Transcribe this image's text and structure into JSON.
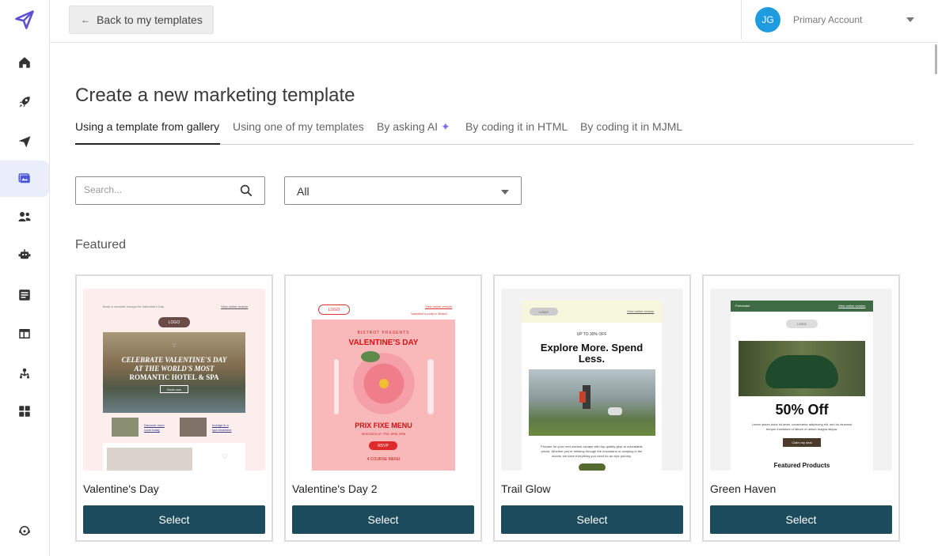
{
  "topbar": {
    "back_label": "Back to my templates",
    "account_initials": "JG",
    "account_name": "Primary Account"
  },
  "sidebar": {
    "items": [
      {
        "icon": "logo-paper-plane-icon"
      },
      {
        "icon": "home-icon"
      },
      {
        "icon": "rocket-icon"
      },
      {
        "icon": "send-icon"
      },
      {
        "icon": "templates-icon",
        "active": true
      },
      {
        "icon": "contacts-icon"
      },
      {
        "icon": "robot-icon"
      },
      {
        "icon": "forms-icon"
      },
      {
        "icon": "layout-icon"
      },
      {
        "icon": "integrations-icon"
      },
      {
        "icon": "apps-icon"
      },
      {
        "icon": "support-icon"
      }
    ]
  },
  "page": {
    "title": "Create a new marketing template",
    "tabs": [
      {
        "label": "Using a template from gallery",
        "active": true
      },
      {
        "label": "Using one of my templates"
      },
      {
        "label": "By asking AI"
      },
      {
        "label": "By coding it in HTML"
      },
      {
        "label": "By coding it in MJML"
      }
    ]
  },
  "search": {
    "placeholder": "Search..."
  },
  "filter": {
    "value": "All"
  },
  "section": {
    "title": "Featured"
  },
  "cards": [
    {
      "name": "Valentine's Day",
      "button": "Select",
      "preview": {
        "preheader": "Book a romantic escape for Valentine's Day",
        "view_online": "View online version",
        "logo": "LOGO",
        "headline_1": "CELEBRATE VALENTINE'S DAY",
        "headline_2": "AT THE WORLD'S MOST",
        "headline_3": "ROMANTIC HOTEL & SPA",
        "cta": "Book now",
        "link_1": "Discover more",
        "link_1b": "room today",
        "link_2": "Indulge in a",
        "link_2b": "spa treatment"
      }
    },
    {
      "name": "Valentine's Day 2",
      "button": "Select",
      "preview": {
        "logo": "LOGO",
        "view_online": "View online version",
        "party": "Valentine's party in Bristol",
        "presents": "BISTROT PRESENTS",
        "headline": "VALENTINE'S DAY",
        "menu": "PRIX FIXE MENU",
        "dates": "SEATINGS AT 7PM, 8PM, 9PM",
        "rsvp": "RSVP",
        "courses": "4 COURSE MENU"
      }
    },
    {
      "name": "Trail Glow",
      "button": "Select",
      "preview": {
        "logo": "LOGO",
        "view_online": "View online version",
        "offer": "UP TO 30% OFF",
        "headline_1": "Explore More. Spend",
        "headline_2": "Less.",
        "body_1": "Prepare for your next outdoor escape with top-quality gear at unbeatable",
        "body_2": "prices. Whether you're trekking through the mountains or camping in the",
        "body_3": "woods, we have everything you need for an epic journey."
      }
    },
    {
      "name": "Green Haven",
      "button": "Select",
      "preview": {
        "preheader": "Preheader",
        "view_online": "View online version",
        "logo": "LOGO",
        "headline": "50% Off",
        "body_1": "Lorem ipsum dolor sit amet, consectetur adipiscing elit, sed do eiusmod",
        "body_2": "tempor incididunt ut labore et dolore magna aliqua.",
        "cta": "Claim my deal",
        "section": "Featured Products"
      }
    }
  ],
  "colors": {
    "accent": "#1b4b5d",
    "avatar": "#1f9be0",
    "active_nav": "#eaeefb",
    "brand": "#5b4fd6"
  }
}
